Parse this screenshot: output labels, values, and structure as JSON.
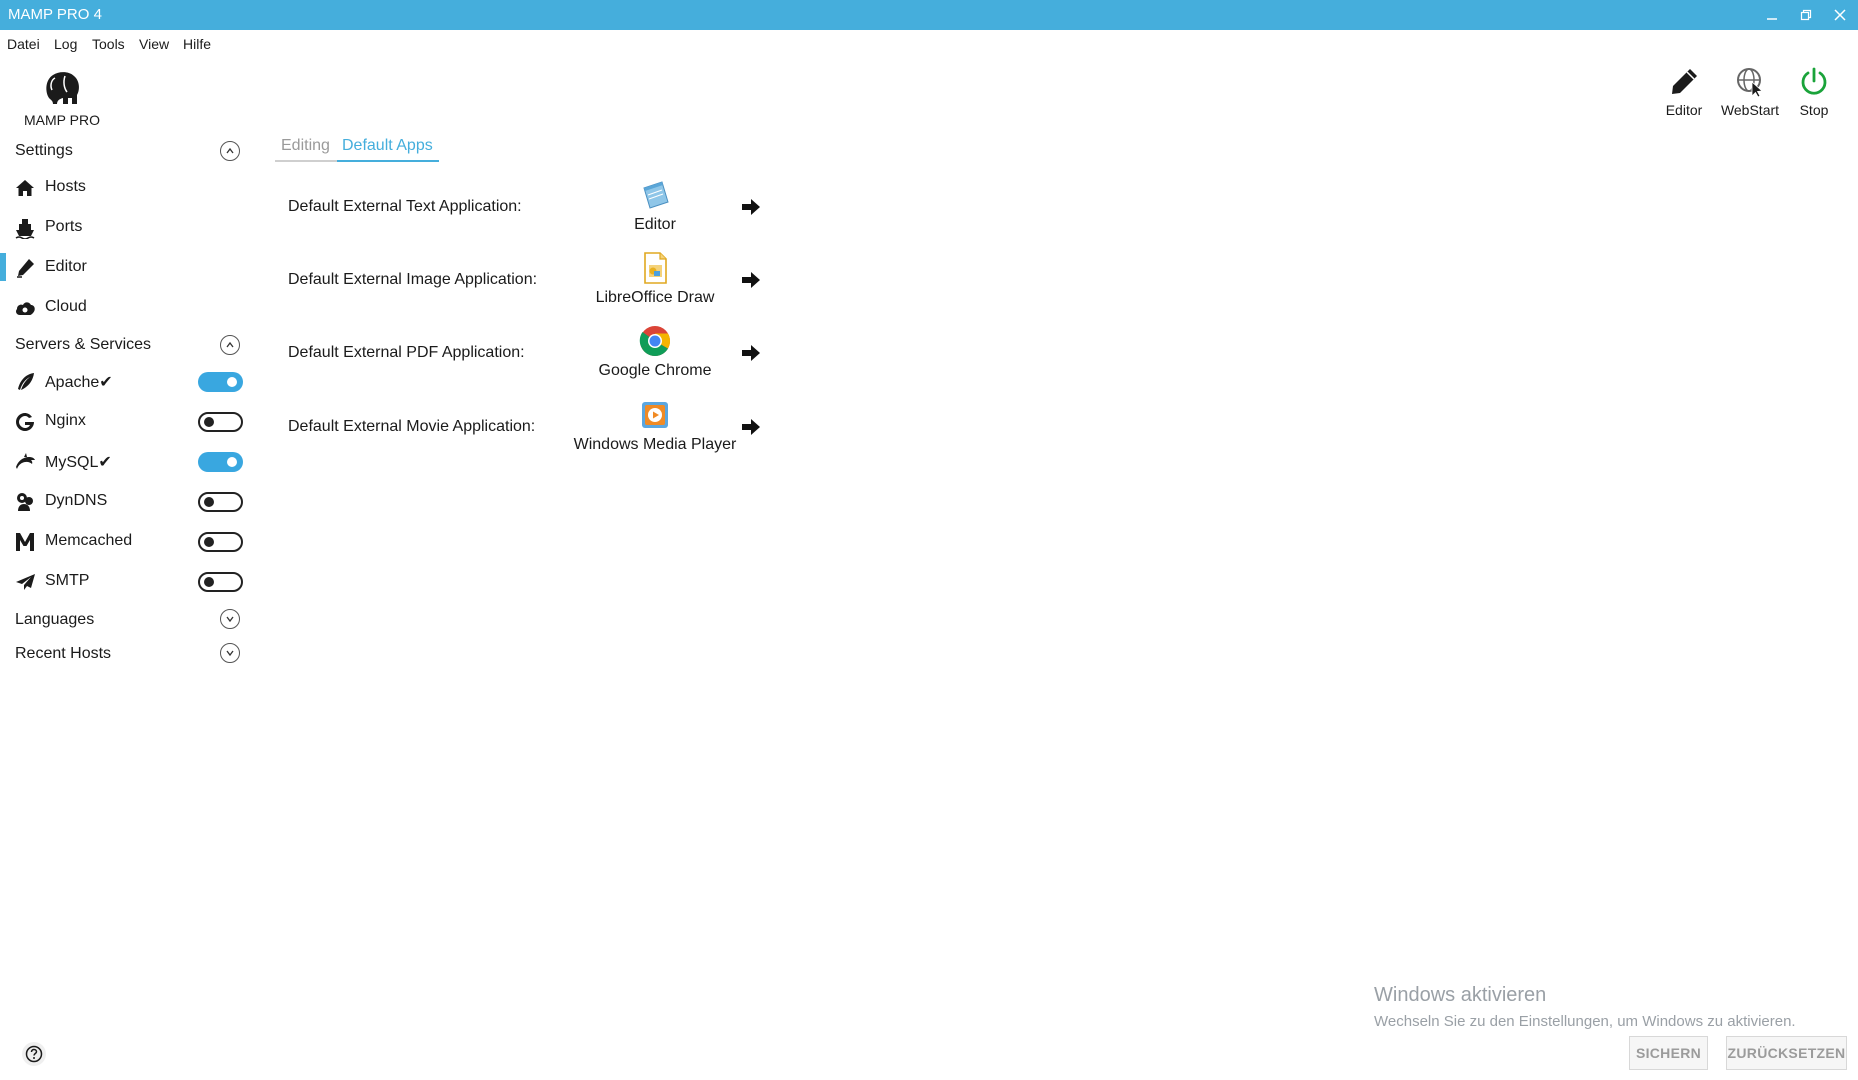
{
  "window": {
    "title": "MAMP PRO 4",
    "title_bar_color": "#45aedc"
  },
  "menu": [
    "Datei",
    "Log",
    "Tools",
    "View",
    "Hilfe"
  ],
  "logo": {
    "label": "MAMP PRO",
    "icon": "elephant-icon"
  },
  "sidebar": {
    "settings": {
      "title": "Settings",
      "expanded": true,
      "items": [
        {
          "label": "Hosts",
          "icon": "home-icon"
        },
        {
          "label": "Ports",
          "icon": "ship-icon"
        },
        {
          "label": "Editor",
          "icon": "pen-icon",
          "active": true
        },
        {
          "label": "Cloud",
          "icon": "cloud-icon"
        }
      ]
    },
    "servers": {
      "title": "Servers & Services",
      "expanded": true,
      "items": [
        {
          "label": "Apache✔",
          "icon": "feather-icon",
          "enabled": true
        },
        {
          "label": "Nginx",
          "icon": "nginx-icon",
          "enabled": false
        },
        {
          "label": "MySQL✔",
          "icon": "dolphin-icon",
          "enabled": true
        },
        {
          "label": "DynDNS",
          "icon": "dyndns-icon",
          "enabled": false
        },
        {
          "label": "Memcached",
          "icon": "memcached-icon",
          "enabled": false
        },
        {
          "label": "SMTP",
          "icon": "paper-plane-icon",
          "enabled": false
        }
      ]
    },
    "languages": {
      "title": "Languages",
      "expanded": false
    },
    "recent_hosts": {
      "title": "Recent Hosts",
      "expanded": false
    }
  },
  "tabs": [
    {
      "label": "Editing",
      "active": false
    },
    {
      "label": "Default Apps",
      "active": true
    }
  ],
  "default_apps": [
    {
      "label": "Default External Text Application:",
      "app": "Editor",
      "icon": "notepad-icon"
    },
    {
      "label": "Default External Image Application:",
      "app": "LibreOffice Draw",
      "icon": "libreoffice-draw-icon"
    },
    {
      "label": "Default External PDF Application:",
      "app": "Google Chrome",
      "icon": "chrome-icon"
    },
    {
      "label": "Default External Movie Application:",
      "app": "Windows Media Player",
      "icon": "media-player-icon"
    }
  ],
  "toolbar": {
    "editor": "Editor",
    "webstart": "WebStart",
    "stop": "Stop"
  },
  "watermark": {
    "title": "Windows aktivieren",
    "subtitle": "Wechseln Sie zu den Einstellungen, um Windows zu aktivieren."
  },
  "footer": {
    "save": "SICHERN",
    "reset": "ZURÜCKSETZEN"
  },
  "colors": {
    "accent": "#45aedc",
    "toggle_on": "#39a7e0",
    "stop_green": "#1aa33a",
    "tab_inactive": "#9a9a9a"
  }
}
